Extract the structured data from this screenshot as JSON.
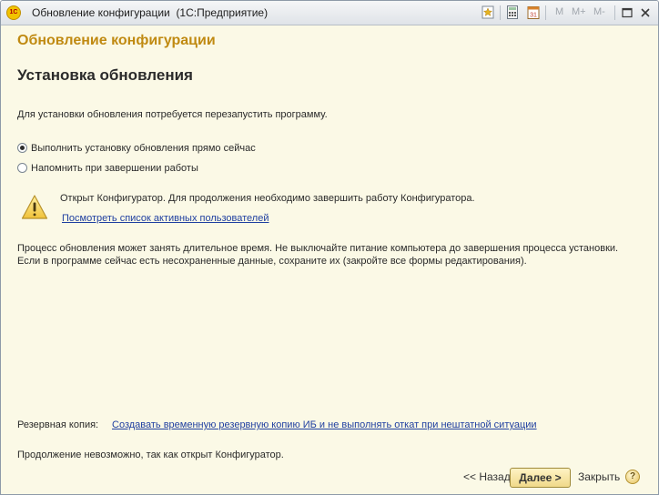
{
  "window": {
    "app_logo": "1С",
    "title": "Обновление конфигурации",
    "subtitle": "(1С:Предприятие)",
    "toolbar": {
      "m": "M",
      "m_plus": "M+",
      "m_minus": "M-"
    }
  },
  "form": {
    "title": "Обновление конфигурации",
    "section_title": "Установка обновления",
    "restart_note": "Для установки обновления потребуется перезапустить программу.",
    "options": [
      {
        "label": "Выполнить установку обновления прямо сейчас",
        "selected": true
      },
      {
        "label": "Напомнить при завершении работы",
        "selected": false
      }
    ],
    "warning": {
      "icon": "warning-triangle-icon",
      "text": "Открыт Конфигуратор. Для продолжения необходимо завершить работу Конфигуратора.",
      "link": "Посмотреть список активных пользователей"
    },
    "info_line1": "Процесс обновления может занять длительное время. Не выключайте питание компьютера до завершения процесса установки.",
    "info_line2": "Если в программе сейчас есть несохраненные данные, сохраните их (закройте все формы редактирования).",
    "backup_label": "Резервная копия:",
    "backup_link": "Создавать временную резервную копию ИБ и не выполнять откат при нештатной ситуации",
    "status": "Продолжение невозможно, так как открыт Конфигуратор."
  },
  "footer": {
    "back": "<< Назад",
    "next": "Далее >",
    "close": "Закрыть",
    "help": "?"
  },
  "colors": {
    "background": "#fbf9e6",
    "title_accent": "#c08a12",
    "link": "#1f3fa0"
  }
}
